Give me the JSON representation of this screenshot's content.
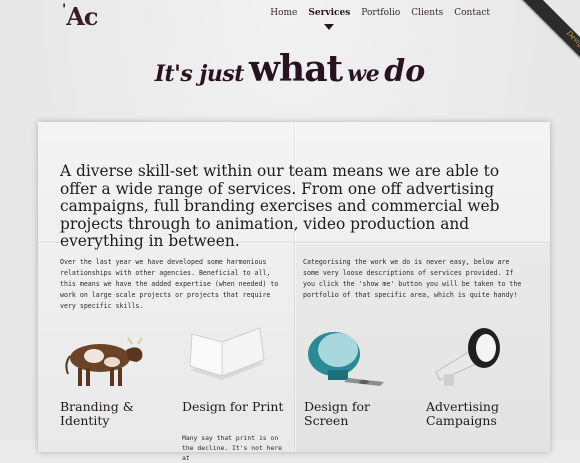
{
  "logo": {
    "mark": "'",
    "text": "Ac"
  },
  "nav": {
    "items": [
      {
        "label": "Home"
      },
      {
        "label": "Services"
      },
      {
        "label": "Portfolio"
      },
      {
        "label": "Clients"
      },
      {
        "label": "Contact"
      }
    ],
    "active_index": 1
  },
  "ribbon": {
    "label": "Design"
  },
  "headline": {
    "part1": "It's just",
    "part2": "what",
    "part3": "we",
    "part4": "do"
  },
  "intro": "A diverse skill-set within our team means we are able to offer a wide range of services. From one off advertising campaigns, full branding exercises and commercial web projects through to animation, video production and everything in between.",
  "columns": {
    "left": "Over the last year we have developed some harmonious relationships with other agencies. Beneficial to all, this means we have the added expertise (when needed) to work on large scale projects or projects that require very specific skills.",
    "right": "Categorising the work we do is never easy, below are some very loose descriptions of services provided. If you click the 'show me' button you will be taken to the portfolio of that specific area, which is quite handy!"
  },
  "services": [
    {
      "title": "Branding & Identity",
      "icon": "cow-icon",
      "desc": ""
    },
    {
      "title": "Design for Print",
      "icon": "book-icon",
      "desc": "Many say that print is on the decline. It's not here at"
    },
    {
      "title": "Design for Screen",
      "icon": "imac-icon",
      "desc": ""
    },
    {
      "title": "Advertising Campaigns",
      "icon": "megaphone-icon",
      "desc": ""
    }
  ]
}
